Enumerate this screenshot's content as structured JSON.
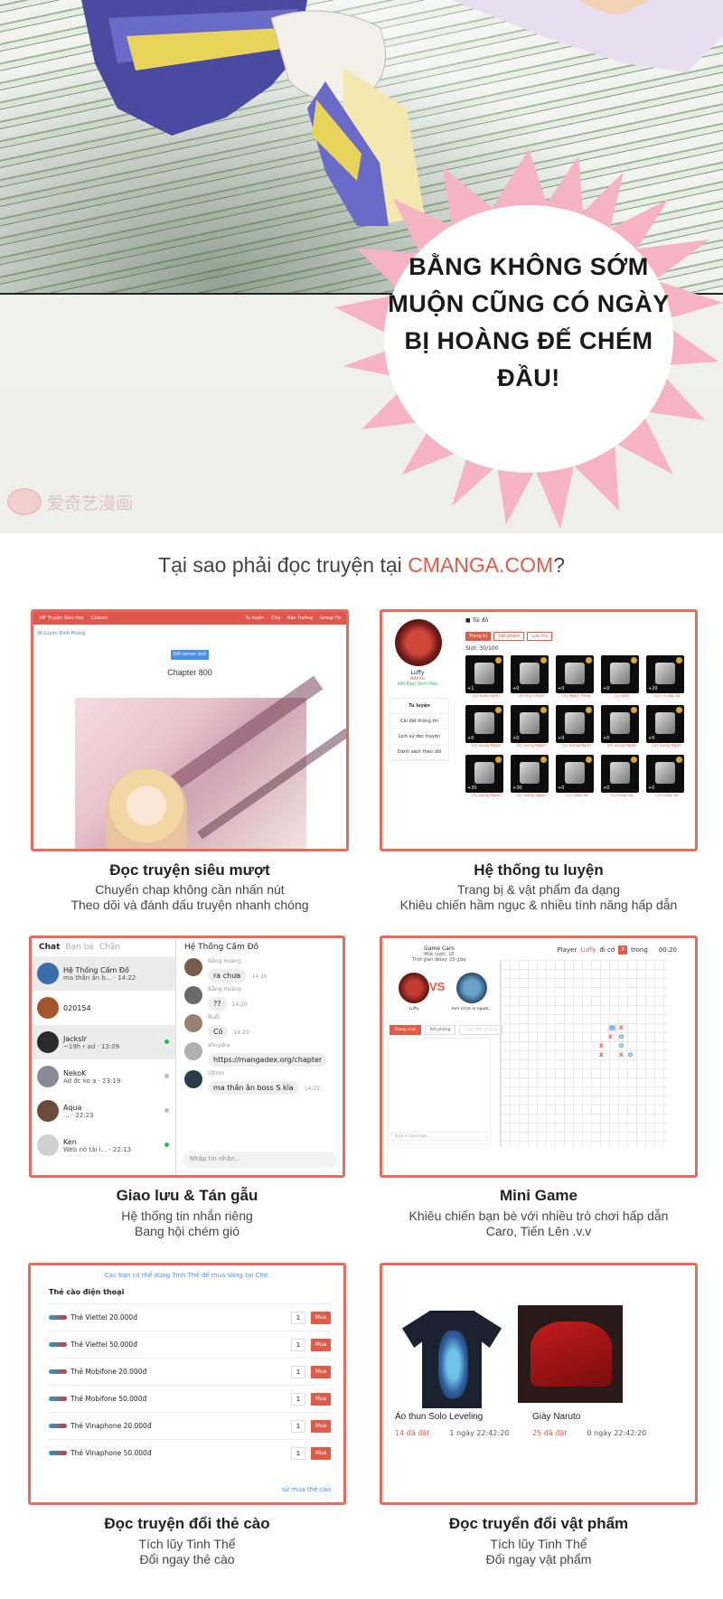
{
  "speech_bubble": "BẰNG KHÔNG SỚM MUỘN CŨNG CÓ NGÀY BỊ HOÀNG ĐẾ CHÉM ĐẦU!",
  "watermark": "爱奇艺漫画",
  "headline": {
    "before": "Tại sao phải đọc truyện tại ",
    "brand": "CMANGA.COM",
    "after": "?"
  },
  "colors": {
    "accent": "#e05a48",
    "card_border": "#e56b5c",
    "link": "#4a8fe8"
  },
  "features": [
    {
      "title": "Đọc truyện siêu mượt",
      "desc1": "Chuyển chap không cần nhấn nút",
      "desc2": "Theo dõi và đánh dấu truyện nhanh chóng"
    },
    {
      "title": "Hệ thống tu luyện",
      "desc1": "Trang bị & vật phẩm đa dạng",
      "desc2": "Khiêu chiến hầm ngục & nhiều tính năng hấp dẫn"
    },
    {
      "title": "Giao lưu & Tán gẫu",
      "desc1": "Hệ thống tin nhắn riêng",
      "desc2": "Bang hội chém gió"
    },
    {
      "title": "Mini Game",
      "desc1": "Khiêu chiến bạn bè với nhiều trò chơi hấp dẫn",
      "desc2": "Caro, Tiến Lên .v.v"
    },
    {
      "title": "Đọc truyện đổi thẻ cào",
      "desc1": "Tích lũy Tinh Thể",
      "desc2": "Đổi ngay thẻ cào"
    },
    {
      "title": "Đọc truyển đổi vật phẩm",
      "desc1": "Tích lũy Tinh Thể",
      "desc2": "Đổi ngay vật phẩm"
    }
  ],
  "reader": {
    "nav": [
      "VIP Truyện Siêu Hay",
      "Cblovis",
      "Tu luyện",
      "Chợ",
      "Bảo Trưởng",
      "Group Fb"
    ],
    "crumb": "Võ Luyện Đỉnh Phong",
    "server_button": "Đổi server ảnh",
    "chapter": "Chapter 800"
  },
  "inventory": {
    "title": "Túi đồ",
    "tabs": [
      "Trang bị",
      "Vật phẩm",
      "Lưu trữ"
    ],
    "slots_text": "Slot: 30/100",
    "user": "Luffy",
    "role": "Admin",
    "realm": "Kết Đan Sinh Hóa",
    "menu": [
      "Tu luyện",
      "Cài đặt thông tin",
      "Lịch sử đọc truyện",
      "Danh sách theo dõi"
    ],
    "items": [
      {
        "lvl": "+1",
        "label": "[5] Giao Đêm"
      },
      {
        "lvl": "+0",
        "label": "[4] Rìu Chiến"
      },
      {
        "lvl": "+0",
        "label": "[5] Ngọc Phép"
      },
      {
        "lvl": "+0",
        "label": "[5] Đơn"
      },
      {
        "lvl": "+20",
        "label": "[5+] Giáp dà"
      },
      {
        "lvl": "+0",
        "label": "[5] Súng Ngắn"
      },
      {
        "lvl": "+0",
        "label": "[5] Súng Ngắn"
      },
      {
        "lvl": "+0",
        "label": "[5] Súng Ngắn"
      },
      {
        "lvl": "+0",
        "label": "[5] Súng Ngắn"
      },
      {
        "lvl": "+0",
        "label": "[5] Súng Ngắn"
      },
      {
        "lvl": "+30",
        "label": "[5] Súng Ngắn"
      },
      {
        "lvl": "+30",
        "label": "[5] Súng Ngắn"
      },
      {
        "lvl": "+0",
        "label": "[5] Giáp dà"
      },
      {
        "lvl": "+0",
        "label": "[5] Giáp dà"
      },
      {
        "lvl": "+0",
        "label": "[5] Giáp dà"
      }
    ]
  },
  "chat": {
    "tabs": [
      "Chat",
      "Bạn bè",
      "Chặn"
    ],
    "room": "Hệ Thống Cấm Đồ",
    "contacts": [
      {
        "name": "Hệ Thống Cấm Đồ",
        "msg": "ma thần ân b... · 14:22",
        "dot": ""
      },
      {
        "name": "020154",
        "msg": "",
        "dot": ""
      },
      {
        "name": "Jackslr",
        "msg": "~19h r ad · 13:09",
        "dot": "g"
      },
      {
        "name": "NekoK",
        "msg": "Ad đc ko a · 23:19",
        "dot": "n"
      },
      {
        "name": "Aqua",
        "msg": "... · 22:23",
        "dot": "n"
      },
      {
        "name": "Ken",
        "msg": "Web nó tải l... · 22:13",
        "dot": "g"
      }
    ],
    "messages": [
      {
        "who": "Bằng Hoàng",
        "text": "ra chưa",
        "time": "14:20"
      },
      {
        "who": "Bằng Hoàng",
        "text": "??",
        "time": "14:20"
      },
      {
        "who": "Buồi",
        "text": "Có",
        "time": "14:20"
      },
      {
        "who": "shuydra",
        "text": "https://mangadex.org/chapter",
        "time": ""
      },
      {
        "who": "Ultron",
        "text": "ma thần ân boss S kìa",
        "time": "14:21"
      }
    ],
    "input_placeholder": "Nhập tin nhắn..."
  },
  "caro": {
    "title": "Game Caro",
    "bet": "Mức cược: 10",
    "delay": "Thời gian delay: 20 giây",
    "p1": "Luffy",
    "p2": "Anh có tê là người...",
    "vs": "VS",
    "buttons": [
      "Đang chơi",
      "Rời phòng",
      "Loại khỏi phòng"
    ],
    "status_before": "Player",
    "status_player": "Luffy",
    "status_after": "đi cờ",
    "mark": "X",
    "time_label": "trong",
    "time": "00:20",
    "chat_placeholder": "Type a message..."
  },
  "cards": {
    "note": "Các bạn có thể dùng Tinh Thể để mua Vàng tại Chợ.",
    "heading": "Thẻ cào điện thoại",
    "rows": [
      {
        "name": "Thẻ Viettel 20.000đ",
        "qty": "1",
        "buy": "Mua"
      },
      {
        "name": "Thẻ Viettel 50.000đ",
        "qty": "1",
        "buy": "Mua"
      },
      {
        "name": "Thẻ Mobifone 20.000đ",
        "qty": "1",
        "buy": "Mua"
      },
      {
        "name": "Thẻ Mobifone 50.000đ",
        "qty": "1",
        "buy": "Mua"
      },
      {
        "name": "Thẻ Vinaphone 20.000đ",
        "qty": "1",
        "buy": "Mua"
      },
      {
        "name": "Thẻ Vinaphone 50.000đ",
        "qty": "1",
        "buy": "Mua"
      }
    ],
    "more": "sử mua thẻ cào"
  },
  "shop": {
    "items": [
      {
        "name": "Áo thun Solo Leveling",
        "count": "14 đã đặt",
        "time": "1 ngày 22:42:20"
      },
      {
        "name": "Giày Naruto",
        "count": "25 đã đặt",
        "time": "0 ngày 22:42:20"
      }
    ]
  }
}
